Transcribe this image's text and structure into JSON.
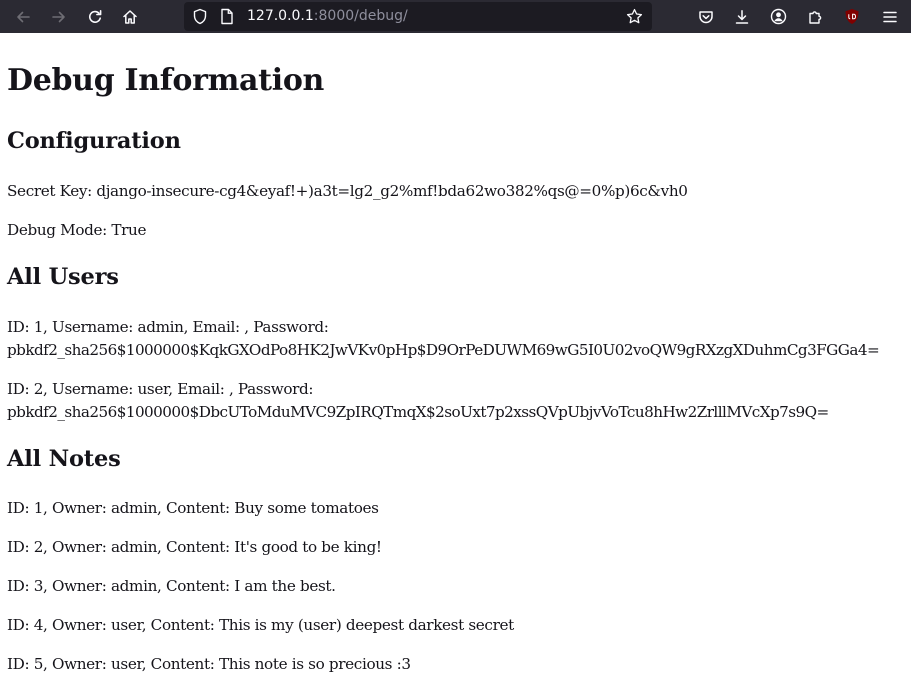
{
  "browser": {
    "url_host": "127.0.0.1",
    "url_rest": ":8000/debug/"
  },
  "page": {
    "title": "Debug Information",
    "configuration": {
      "heading": "Configuration",
      "secret_key": "Secret Key: django-insecure-cg4&eyaf!+)a3t=lg2_g2%mf!bda62wo382%qs@=0%p)6c&vh0",
      "debug_mode": "Debug Mode: True"
    },
    "users": {
      "heading": "All Users",
      "items": [
        {
          "line1": "ID: 1, Username: admin, Email: , Password:",
          "line2": "pbkdf2_sha256$1000000$KqkGXOdPo8HK2JwVKv0pHp$D9OrPeDUWM69wG5I0U02voQW9gRXzgXDuhmCg3FGGa4="
        },
        {
          "line1": "ID: 2, Username: user, Email: , Password:",
          "line2": "pbkdf2_sha256$1000000$DbcUToMduMVC9ZpIRQTmqX$2soUxt7p2xssQVpUbjvVoTcu8hHw2ZrlllMVcXp7s9Q="
        }
      ]
    },
    "notes": {
      "heading": "All Notes",
      "items": [
        "ID: 1, Owner: admin, Content: Buy some tomatoes",
        "ID: 2, Owner: admin, Content: It's good to be king!",
        "ID: 3, Owner: admin, Content: I am the best.",
        "ID: 4, Owner: user, Content: This is my (user) deepest darkest secret",
        "ID: 5, Owner: user, Content: This note is so precious :3"
      ]
    }
  }
}
